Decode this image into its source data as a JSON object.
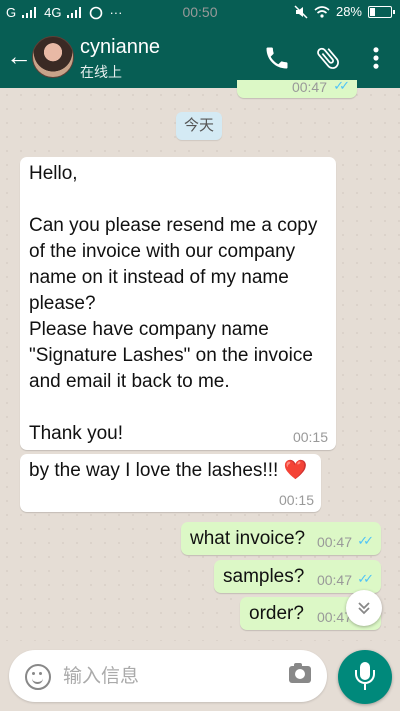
{
  "status_bar": {
    "left_text": "G",
    "network": "4G",
    "time": "00:50",
    "battery": "28%"
  },
  "header": {
    "back_icon": "arrow-back-icon",
    "contact_name": "cynianne",
    "contact_status": "在线上",
    "actions": [
      "phone-icon",
      "attach-icon",
      "more-icon"
    ]
  },
  "chat": {
    "top_partial_time": "00:47",
    "date_chip": "今天",
    "messages": [
      {
        "direction": "in",
        "text": "Hello,\n\nCan you please resend me a copy of the invoice with our company name on it instead of my name please?\nPlease have company name \"Signature Lashes\" on the invoice and email it back to me.\n\nThank you!",
        "time": "00:15"
      },
      {
        "direction": "in",
        "text": "by the way I love the lashes!!! ❤️",
        "time": "00:15"
      },
      {
        "direction": "out",
        "text": "what invoice?",
        "time": "00:47",
        "ticks": "✓✓"
      },
      {
        "direction": "out",
        "text": "samples?",
        "time": "00:47",
        "ticks": "✓✓"
      },
      {
        "direction": "out",
        "text": "order?",
        "time": "00:47",
        "ticks": "✓✓"
      }
    ]
  },
  "input": {
    "placeholder": "输入信息",
    "value": ""
  },
  "colors": {
    "header": "#075e54",
    "outgoing_bubble": "#dcf8c6",
    "incoming_bubble": "#ffffff",
    "mic_button": "#00897b",
    "read_ticks": "#4fc3f7"
  }
}
